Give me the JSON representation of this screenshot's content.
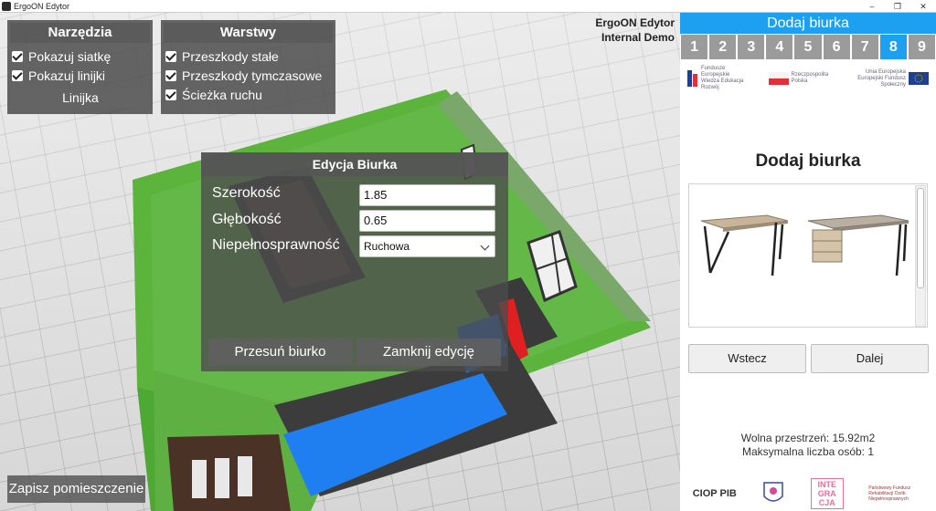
{
  "window": {
    "title": "ErgoON Edytor",
    "controls": [
      "–",
      "❐",
      "✕"
    ]
  },
  "tools_panel": {
    "title": "Narzędzia",
    "show_grid": "Pokazuj siatkę",
    "show_rulers": "Pokazuj linijki",
    "ruler_button": "Linijka"
  },
  "layers_panel": {
    "title": "Warstwy",
    "items": [
      "Przeszkody stałe",
      "Przeszkody tymczasowe",
      "Ścieżka ruchu"
    ]
  },
  "demo_label": {
    "line1": "ErgoON Edytor",
    "line2": "Internal Demo"
  },
  "edit_dialog": {
    "title": "Edycja Biurka",
    "width_label": "Szerokość",
    "width_value": "1.85",
    "depth_label": "Głębokość",
    "depth_value": "0.65",
    "disability_label": "Niepełnosprawność",
    "disability_value": "Ruchowa",
    "move_button": "Przesuń biurko",
    "close_button": "Zamknij edycję"
  },
  "save_room_button": "Zapisz pomieszczenie",
  "side_panel": {
    "header": "Dodaj biurka",
    "steps": [
      "1",
      "2",
      "3",
      "4",
      "5",
      "6",
      "7",
      "8",
      "9"
    ],
    "active_step": 8,
    "logos_top": [
      {
        "text": "Fundusze Europejskie Wiedza Edukacja Rozwój"
      },
      {
        "text": "Rzeczpospolita Polska"
      },
      {
        "text": "Unia Europejska Europejski Fundusz Społeczny"
      }
    ],
    "title": "Dodaj biurka",
    "back_button": "Wstecz",
    "next_button": "Dalej",
    "free_space": "Wolna przestrzeń: 15.92m2",
    "max_people": "Maksymalna liczba osób: 1",
    "logos_bottom": [
      "CIOP PIB",
      "INTE GRA CJA",
      "Państwowy Fundusz Rehabilitacji Osób Niepełnosprawnych"
    ]
  },
  "colors": {
    "accent": "#1ea0f0",
    "room_green": "#5cb43c",
    "path_blue": "#1f7ff0",
    "obstacle_red": "#e02020"
  }
}
